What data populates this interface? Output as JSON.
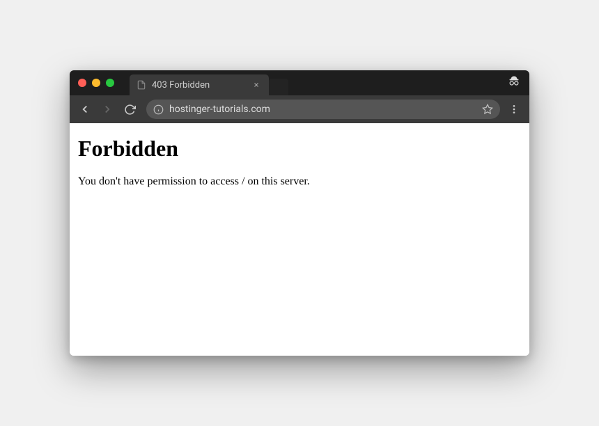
{
  "tab": {
    "title": "403 Forbidden"
  },
  "address": {
    "url": "hostinger-tutorials.com"
  },
  "page": {
    "heading": "Forbidden",
    "message": "You don't have permission to access / on this server."
  }
}
